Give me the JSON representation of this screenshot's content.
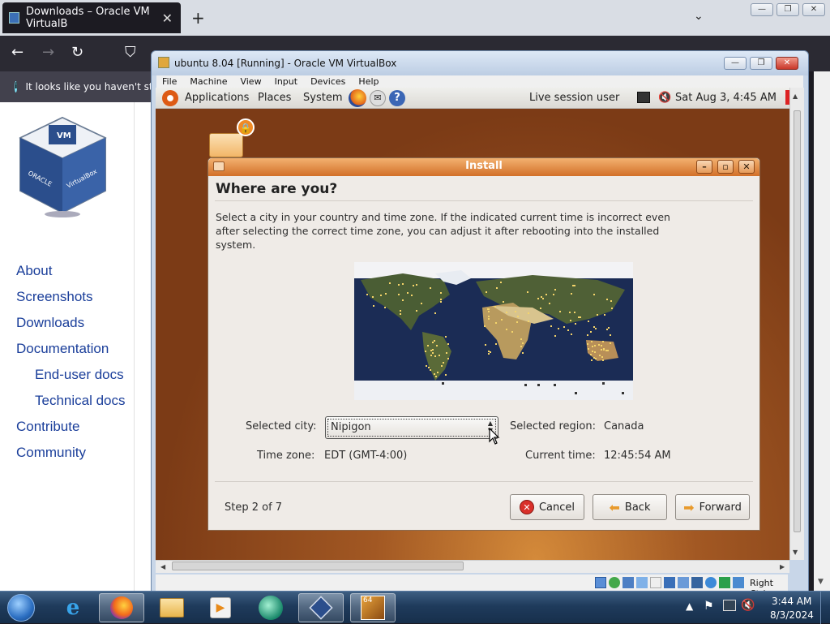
{
  "browser": {
    "tab_title": "Downloads – Oracle VM VirtualB",
    "tab_close": "✕",
    "new_tab": "+",
    "tabs_dropdown": "⌄",
    "window_buttons": [
      "—",
      "❐",
      "✕"
    ],
    "infobar_text": "It looks like you haven't sta"
  },
  "site": {
    "nav": [
      {
        "label": "About",
        "indent": false
      },
      {
        "label": "Screenshots",
        "indent": false
      },
      {
        "label": "Downloads",
        "indent": false
      },
      {
        "label": "Documentation",
        "indent": false
      },
      {
        "label": "End-user docs",
        "indent": true
      },
      {
        "label": "Technical docs",
        "indent": true
      },
      {
        "label": "Contribute",
        "indent": false
      },
      {
        "label": "Community",
        "indent": false
      }
    ],
    "logo_text": [
      "ORACLE",
      "VirtualBox"
    ]
  },
  "vbox": {
    "title": "ubuntu 8.04 [Running] - Oracle VM VirtualBox",
    "menu": [
      "File",
      "Machine",
      "View",
      "Input",
      "Devices",
      "Help"
    ],
    "host_key": "Right Ctrl"
  },
  "guest": {
    "panel": {
      "applications": "Applications",
      "places": "Places",
      "system": "System",
      "user": "Live session user",
      "datetime": "Sat Aug  3,  4:45 AM"
    },
    "dialog": {
      "title": "Install",
      "heading": "Where are you?",
      "description": "Select a city in your country and time zone. If the indicated current time is incorrect even after selecting the correct time zone, you can adjust it after rebooting into the installed system.",
      "selected_city_label": "Selected city:",
      "selected_city_value": "Nipigon",
      "selected_region_label": "Selected region:",
      "selected_region_value": "Canada",
      "time_zone_label": "Time zone:",
      "time_zone_value": "EDT (GMT-4:00)",
      "current_time_label": "Current time:",
      "current_time_value": "12:45:54 AM",
      "step": "Step 2 of 7",
      "cancel": "Cancel",
      "back": "Back",
      "forward": "Forward"
    }
  },
  "taskbar": {
    "time": "3:44 AM",
    "date": "8/3/2024"
  },
  "colors": {
    "accent_orange": "#d26f28",
    "link_blue": "#1a3e9a"
  }
}
